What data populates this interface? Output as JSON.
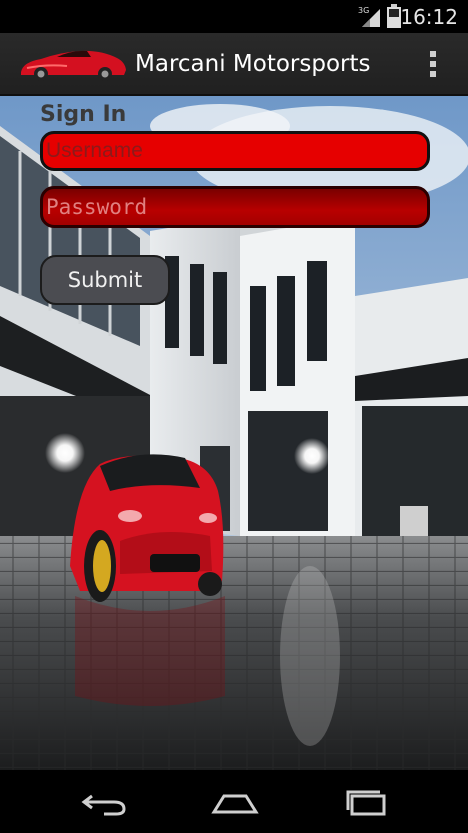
{
  "status_bar": {
    "time": "16:12",
    "network": "3G",
    "signal_icon": "signal-icon",
    "battery_icon": "battery-icon"
  },
  "action_bar": {
    "title": "Marcani Motorsports",
    "logo_icon": "red-sports-car-logo",
    "overflow_icon": "overflow-menu-icon"
  },
  "form": {
    "heading": "Sign In",
    "username_placeholder": "Username",
    "password_placeholder": "Password",
    "submit_label": "Submit"
  },
  "nav_bar": {
    "back_icon": "back-icon",
    "home_icon": "home-icon",
    "recents_icon": "recents-icon"
  },
  "colors": {
    "accent_red": "#e60000",
    "action_bar": "#262626",
    "button": "#4b4c51"
  }
}
